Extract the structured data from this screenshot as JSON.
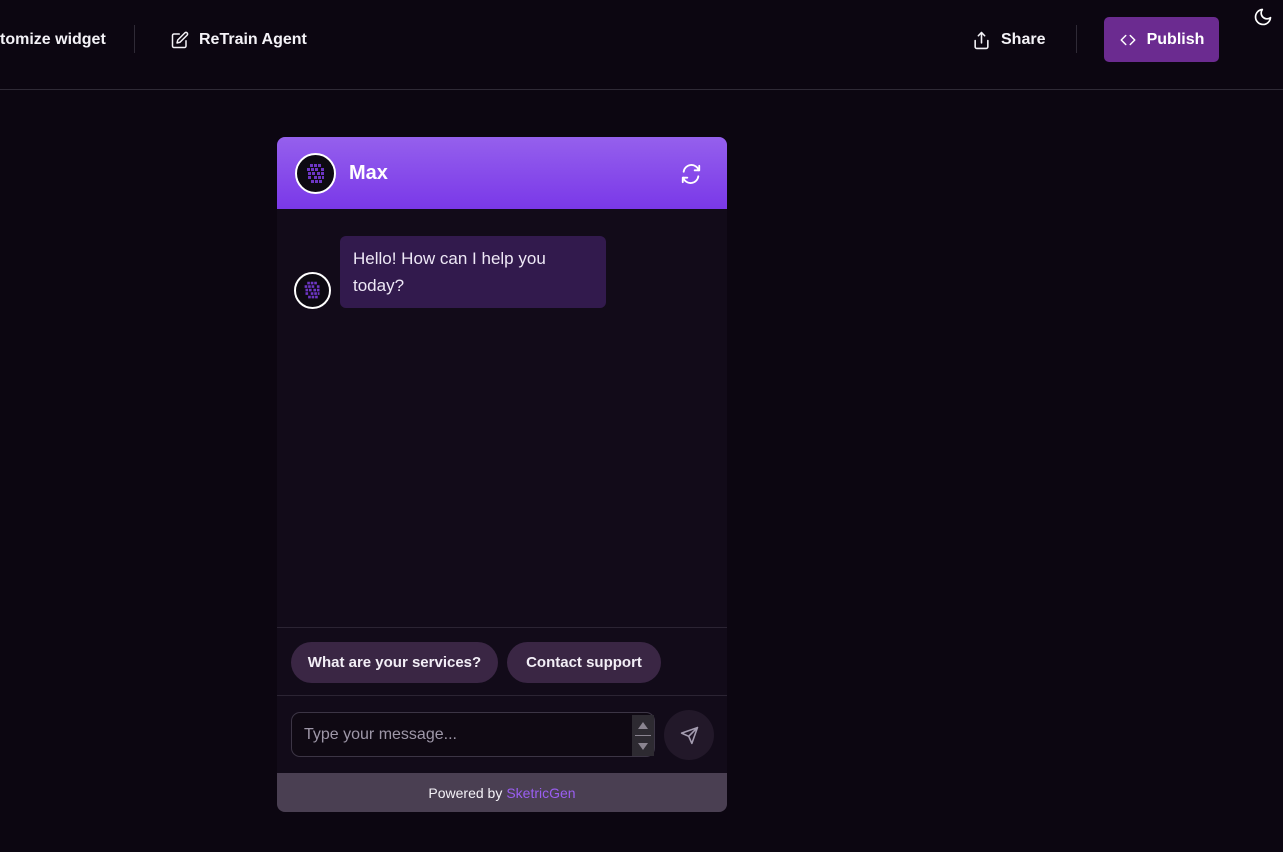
{
  "toolbar": {
    "customize_label": "tomize widget",
    "retrain_label": "ReTrain Agent",
    "share_label": "Share",
    "publish_label": "Publish",
    "icons": {
      "retrain": "edit-icon",
      "share": "share-icon",
      "publish": "code-icon",
      "theme": "moon-icon"
    }
  },
  "widget": {
    "agent_name": "Max",
    "header_colors": [
      "#9560ed",
      "#7a38e8"
    ],
    "messages": [
      {
        "role": "bot",
        "text": "Hello! How can I help you today?"
      }
    ],
    "quick_replies": [
      "What are your services?",
      "Contact support"
    ],
    "input": {
      "placeholder": "Type your message...",
      "value": ""
    },
    "footer": {
      "powered_by": "Powered by",
      "brand": "SketricGen",
      "brand_color": "#9a5ef0"
    },
    "icons": {
      "avatar": "logo-icon",
      "refresh": "refresh-icon",
      "send": "send-icon"
    }
  }
}
